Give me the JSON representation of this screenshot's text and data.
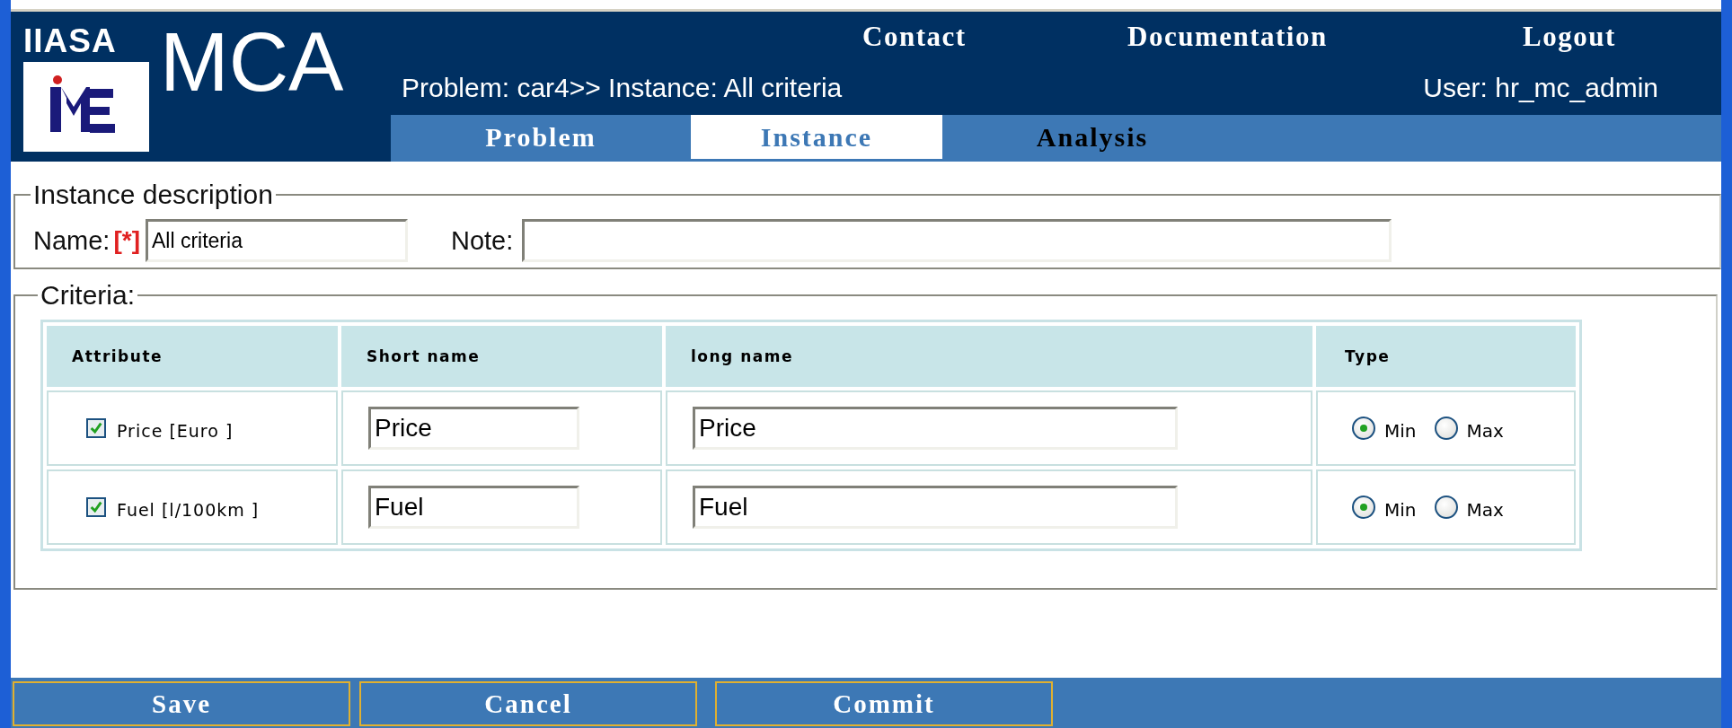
{
  "logo": {
    "org": "IIASA",
    "app": "MCA"
  },
  "header_links": [
    "Contact",
    "Documentation",
    "Logout"
  ],
  "breadcrumb": "Problem: car4>> Instance: All criteria",
  "user": "User: hr_mc_admin",
  "tabs": [
    {
      "label": "Problem",
      "selected": false
    },
    {
      "label": "Instance",
      "selected": true
    },
    {
      "label": "Analysis",
      "selected": false
    }
  ],
  "instance_description": {
    "legend": "Instance description",
    "name_label": "Name:",
    "required_mark": "[*]",
    "name_value": "All criteria",
    "note_label": "Note:"
  },
  "criteria": {
    "legend": "Criteria:",
    "columns": [
      "Attribute",
      "Short name",
      "long name",
      "Type"
    ],
    "rows": [
      {
        "checked": true,
        "attribute": "Price [Euro ]",
        "short_name": "Price",
        "long_name": "Price",
        "type_options": [
          {
            "label": "Min",
            "selected": true
          },
          {
            "label": "Max",
            "selected": false
          }
        ]
      },
      {
        "checked": true,
        "attribute": "Fuel [l/100km ]",
        "short_name": "Fuel",
        "long_name": "Fuel",
        "type_options": [
          {
            "label": "Min",
            "selected": true
          },
          {
            "label": "Max",
            "selected": false
          }
        ]
      }
    ]
  },
  "buttons": [
    "Save",
    "Cancel",
    "Commit"
  ]
}
